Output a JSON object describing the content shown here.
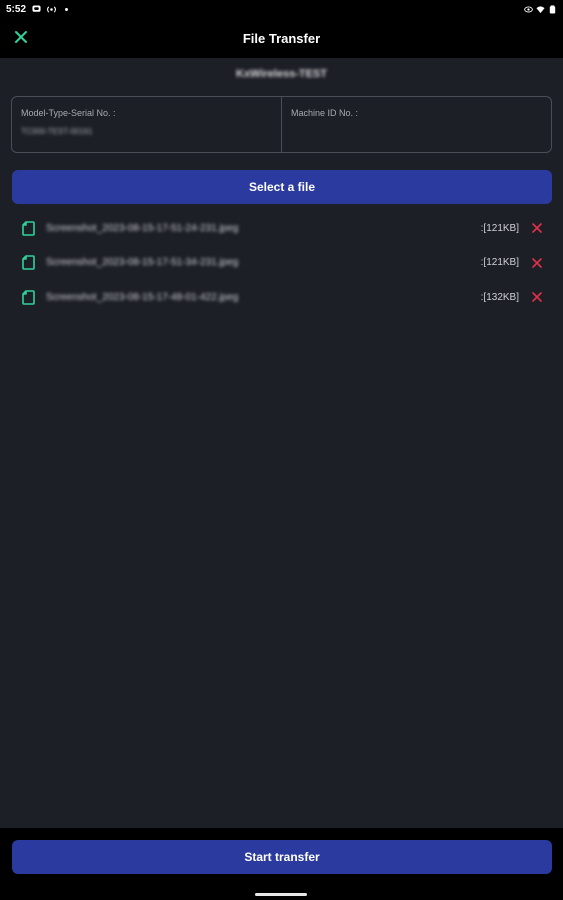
{
  "status_bar": {
    "time": "5:52",
    "icons": [
      "message-icon",
      "broadcast-icon",
      "dot-icon",
      "eye-icon",
      "wifi-icon",
      "battery-icon"
    ]
  },
  "app_bar": {
    "title": "File Transfer",
    "close_icon": "close-icon"
  },
  "device": {
    "name": "KxWireless-TEST"
  },
  "info": {
    "model_label": "Model-Type-Serial No. :",
    "model_value": "TC000-TEST-00161",
    "machine_label": "Machine ID No. :",
    "machine_value": ""
  },
  "buttons": {
    "select_file": "Select a file",
    "start_transfer": "Start transfer"
  },
  "files": [
    {
      "name": "Screenshot_2023-08-15-17-51-24-231.jpeg",
      "size": ":[121KB]"
    },
    {
      "name": "Screenshot_2023-08-15-17-51-34-231.jpeg",
      "size": ":[121KB]"
    },
    {
      "name": "Screenshot_2023-08-15-17-48-01-422.jpeg",
      "size": ":[132KB]"
    }
  ],
  "colors": {
    "accent_green": "#2fd39a",
    "button_blue": "#2b3a9e",
    "remove_red": "#e0324a",
    "background": "#1d1f27"
  }
}
